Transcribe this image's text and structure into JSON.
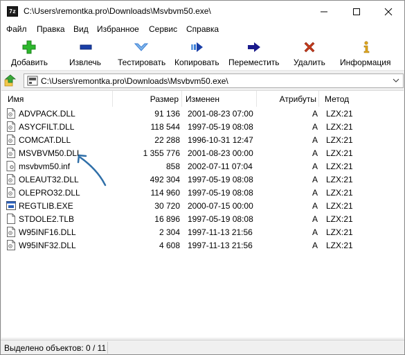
{
  "window": {
    "title": "C:\\Users\\remontka.pro\\Downloads\\Msvbvm50.exe\\",
    "app_icon_text": "7z"
  },
  "menu": [
    "Файл",
    "Правка",
    "Вид",
    "Избранное",
    "Сервис",
    "Справка"
  ],
  "toolbar": {
    "add": "Добавить",
    "extract": "Извлечь",
    "test": "Тестировать",
    "copy": "Копировать",
    "move": "Переместить",
    "delete": "Удалить",
    "info": "Информация"
  },
  "address": {
    "path": "C:\\Users\\remontka.pro\\Downloads\\Msvbvm50.exe\\"
  },
  "columns": {
    "name": "Имя",
    "size": "Размер",
    "modified": "Изменен",
    "attributes": "Атрибуты",
    "method": "Метод"
  },
  "files": [
    {
      "name": "ADVPACK.DLL",
      "size": "91 136",
      "modified": "2001-08-23 07:00",
      "attr": "A",
      "method": "LZX:21",
      "icon": "dll-file-icon"
    },
    {
      "name": "ASYCFILT.DLL",
      "size": "118 544",
      "modified": "1997-05-19 08:08",
      "attr": "A",
      "method": "LZX:21",
      "icon": "dll-file-icon"
    },
    {
      "name": "COMCAT.DLL",
      "size": "22 288",
      "modified": "1996-10-31 12:47",
      "attr": "A",
      "method": "LZX:21",
      "icon": "dll-file-icon"
    },
    {
      "name": "MSVBVM50.DLL",
      "size": "1 355 776",
      "modified": "2001-08-23 00:00",
      "attr": "A",
      "method": "LZX:21",
      "icon": "dll-file-icon"
    },
    {
      "name": "msvbvm50.inf",
      "size": "858",
      "modified": "2002-07-11 07:04",
      "attr": "A",
      "method": "LZX:21",
      "icon": "inf-file-icon"
    },
    {
      "name": "OLEAUT32.DLL",
      "size": "492 304",
      "modified": "1997-05-19 08:08",
      "attr": "A",
      "method": "LZX:21",
      "icon": "dll-file-icon"
    },
    {
      "name": "OLEPRO32.DLL",
      "size": "114 960",
      "modified": "1997-05-19 08:08",
      "attr": "A",
      "method": "LZX:21",
      "icon": "dll-file-icon"
    },
    {
      "name": "REGTLIB.EXE",
      "size": "30 720",
      "modified": "2000-07-15 00:00",
      "attr": "A",
      "method": "LZX:21",
      "icon": "exe-file-icon"
    },
    {
      "name": "STDOLE2.TLB",
      "size": "16 896",
      "modified": "1997-05-19 08:08",
      "attr": "A",
      "method": "LZX:21",
      "icon": "blank-file-icon"
    },
    {
      "name": "W95INF16.DLL",
      "size": "2 304",
      "modified": "1997-11-13 21:56",
      "attr": "A",
      "method": "LZX:21",
      "icon": "dll-file-icon"
    },
    {
      "name": "W95INF32.DLL",
      "size": "4 608",
      "modified": "1997-11-13 21:56",
      "attr": "A",
      "method": "LZX:21",
      "icon": "dll-file-icon"
    }
  ],
  "status": {
    "selected": "Выделено объектов: 0 / 11"
  },
  "colors": {
    "add_green": "#2db82d",
    "extract_blue": "#1a3fa8",
    "test_blue": "#3d7fd6",
    "move_navy": "#1a1a8c",
    "delete_red": "#c43a1c",
    "info_gold": "#e2a81c",
    "annotation_arrow": "#2f6fa8"
  }
}
